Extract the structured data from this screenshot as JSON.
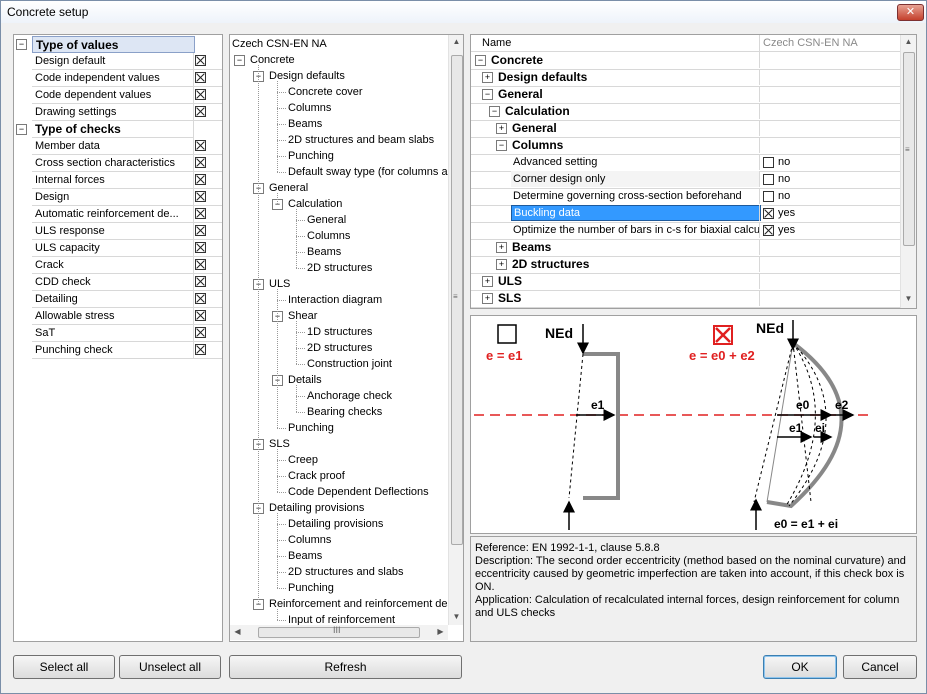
{
  "window": {
    "title": "Concrete setup",
    "close": "✕"
  },
  "panel1": {
    "rows": [
      {
        "label": "Type of values",
        "category": true,
        "expanded": true,
        "selected": true
      },
      {
        "label": "Design default",
        "checked": true
      },
      {
        "label": "Code independent values",
        "checked": true
      },
      {
        "label": "Code dependent values",
        "checked": true
      },
      {
        "label": "Drawing settings",
        "checked": true
      },
      {
        "label": "Type of checks",
        "category": true,
        "expanded": true
      },
      {
        "label": "Member data",
        "checked": true
      },
      {
        "label": "Cross section characteristics",
        "checked": true
      },
      {
        "label": "Internal forces",
        "checked": true
      },
      {
        "label": "Design",
        "checked": true
      },
      {
        "label": "Automatic reinforcement de...",
        "checked": true
      },
      {
        "label": "ULS response",
        "checked": true
      },
      {
        "label": "ULS capacity",
        "checked": true
      },
      {
        "label": "Crack",
        "checked": true
      },
      {
        "label": "CDD check",
        "checked": true
      },
      {
        "label": "Detailing",
        "checked": true
      },
      {
        "label": "Allowable stress",
        "checked": true
      },
      {
        "label": "SaT",
        "checked": true
      },
      {
        "label": "Punching check",
        "checked": true
      }
    ]
  },
  "tree": {
    "root": "Czech CSN-EN NA",
    "nodes": [
      {
        "label": "Concrete",
        "depth": 0,
        "exp": true
      },
      {
        "label": "Design defaults",
        "depth": 1,
        "exp": true
      },
      {
        "label": "Concrete cover",
        "depth": 2
      },
      {
        "label": "Columns",
        "depth": 2
      },
      {
        "label": "Beams",
        "depth": 2
      },
      {
        "label": "2D structures and beam slabs",
        "depth": 2
      },
      {
        "label": "Punching",
        "depth": 2
      },
      {
        "label": "Default sway type (for columns an",
        "depth": 2
      },
      {
        "label": "General",
        "depth": 1,
        "exp": true
      },
      {
        "label": "Calculation",
        "depth": 2,
        "exp": true
      },
      {
        "label": "General",
        "depth": 3
      },
      {
        "label": "Columns",
        "depth": 3
      },
      {
        "label": "Beams",
        "depth": 3
      },
      {
        "label": "2D structures",
        "depth": 3
      },
      {
        "label": "ULS",
        "depth": 1,
        "exp": true
      },
      {
        "label": "Interaction diagram",
        "depth": 2
      },
      {
        "label": "Shear",
        "depth": 2,
        "exp": true
      },
      {
        "label": "1D structures",
        "depth": 3
      },
      {
        "label": "2D structures",
        "depth": 3
      },
      {
        "label": "Construction joint",
        "depth": 3
      },
      {
        "label": "Details",
        "depth": 2,
        "exp": true
      },
      {
        "label": "Anchorage check",
        "depth": 3
      },
      {
        "label": "Bearing checks",
        "depth": 3
      },
      {
        "label": "Punching",
        "depth": 2
      },
      {
        "label": "SLS",
        "depth": 1,
        "exp": true
      },
      {
        "label": "Creep",
        "depth": 2
      },
      {
        "label": "Crack proof",
        "depth": 2
      },
      {
        "label": "Code Dependent Deflections",
        "depth": 2
      },
      {
        "label": "Detailing provisions",
        "depth": 1,
        "exp": true
      },
      {
        "label": "Detailing provisions",
        "depth": 2
      },
      {
        "label": "Columns",
        "depth": 2
      },
      {
        "label": "Beams",
        "depth": 2
      },
      {
        "label": "2D structures and slabs",
        "depth": 2
      },
      {
        "label": "Punching",
        "depth": 2
      },
      {
        "label": "Reinforcement and reinforcement des",
        "depth": 1,
        "exp": true
      },
      {
        "label": "Input of reinforcement",
        "depth": 2
      }
    ],
    "hscroll_grip": "III"
  },
  "grid": {
    "header_name": "Name",
    "header_value": "Czech CSN-EN NA",
    "rows": [
      {
        "label": "Concrete",
        "depth": 0,
        "bold": true,
        "exp": "−"
      },
      {
        "label": "Design defaults",
        "depth": 1,
        "bold": true,
        "exp": "+"
      },
      {
        "label": "General",
        "depth": 1,
        "bold": true,
        "exp": "−"
      },
      {
        "label": "Calculation",
        "depth": 2,
        "bold": true,
        "exp": "−"
      },
      {
        "label": "General",
        "depth": 3,
        "bold": true,
        "exp": "+"
      },
      {
        "label": "Columns",
        "depth": 3,
        "bold": true,
        "exp": "−"
      },
      {
        "label": "Advanced setting",
        "depth": 4,
        "value": "no",
        "checked": false
      },
      {
        "label": "Corner design only",
        "depth": 4,
        "value": "no",
        "checked": false,
        "gray": true
      },
      {
        "label": "Determine governing cross-section beforehand",
        "depth": 4,
        "value": "no",
        "checked": false
      },
      {
        "label": "Buckling data",
        "depth": 4,
        "value": "yes",
        "checked": true,
        "selected": true
      },
      {
        "label": "Optimize the number of bars in c-s for biaxial calcu...",
        "depth": 4,
        "value": "yes",
        "checked": true
      },
      {
        "label": "Beams",
        "depth": 3,
        "bold": true,
        "exp": "+"
      },
      {
        "label": "2D structures",
        "depth": 3,
        "bold": true,
        "exp": "+"
      },
      {
        "label": "ULS",
        "depth": 1,
        "bold": true,
        "exp": "+"
      },
      {
        "label": "SLS",
        "depth": 1,
        "bold": true,
        "exp": "+"
      }
    ]
  },
  "diagram": {
    "left_force": "NEd",
    "left_formula": "e = e1",
    "left_dim": "e1",
    "right_force": "NEd",
    "right_formula": "e = e0 + e2",
    "dim_e0": "e0",
    "dim_e2": "e2",
    "dim_e1": "e1",
    "dim_ei": "ei",
    "bottom_formula": "e0 = e1 + ei",
    "accent": "#e02020"
  },
  "info": {
    "reference": "Reference:    EN 1992-1-1, clause 5.8.8",
    "description": "Description:    The second order eccentricity (method based on the nominal curvature) and eccentricity caused by geometric imperfection are taken into account, if this check box is ON.",
    "application": "Application:    Calculation of recalculated internal forces, design reinforcement for column and ULS checks"
  },
  "buttons": {
    "select_all": "Select all",
    "unselect_all": "Unselect all",
    "refresh": "Refresh",
    "ok": "OK",
    "cancel": "Cancel"
  }
}
